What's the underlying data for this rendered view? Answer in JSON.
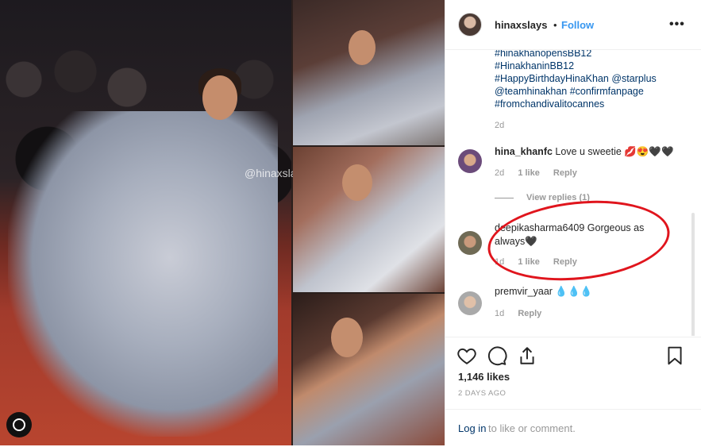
{
  "photo": {
    "watermark": "@hinaxslays"
  },
  "header": {
    "username": "hinaxslays",
    "separator": "•",
    "follow_label": "Follow",
    "more_label": "•••"
  },
  "caption": {
    "lines": [
      "#hinakhanopensBB12",
      "#HinakhaninBB12",
      "#HappyBirthdayHinaKhan @starplus",
      "@teamhinakhan #confirmfanpage",
      "#fromchandivalitocannes"
    ],
    "time": "2d"
  },
  "comments": [
    {
      "user": "hina_khanfc",
      "text": "Love u sweetie 💋😍🖤🖤",
      "time": "2d",
      "likes": "1 like",
      "reply": "Reply",
      "view_replies": "View replies (1)"
    },
    {
      "user": "deepikasharma6409",
      "text": "Gorgeous as always🖤",
      "time": "1d",
      "likes": "1 like",
      "reply": "Reply"
    },
    {
      "user": "premvir_yaar",
      "text": "💧💧💧",
      "time": "1d",
      "reply": "Reply"
    }
  ],
  "actions": {
    "icons": [
      "heart-icon",
      "comment-icon",
      "share-icon",
      "bookmark-icon"
    ],
    "likes": "1,146 likes",
    "date": "2 DAYS AGO",
    "login_link": "Log in",
    "login_rest": "to like or comment."
  },
  "colors": {
    "link": "#003569",
    "follow": "#3897f0",
    "annotation": "#e0151d"
  }
}
